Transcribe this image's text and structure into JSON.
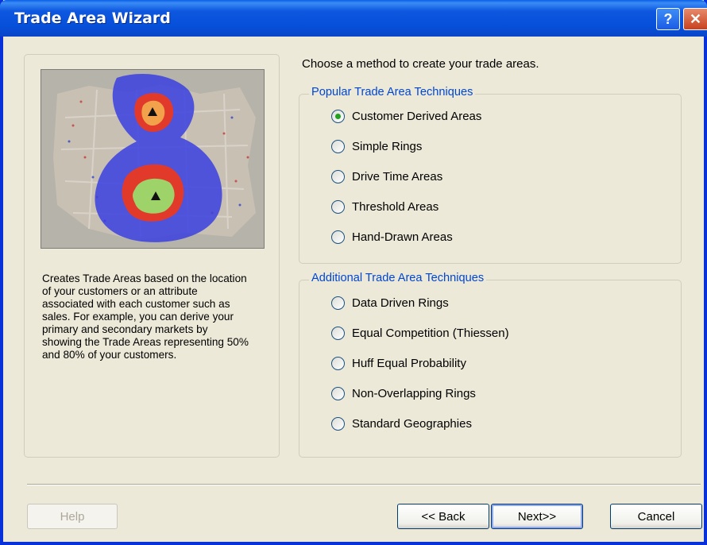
{
  "window": {
    "title": "Trade Area Wizard",
    "help_glyph": "?",
    "close_glyph": "✕"
  },
  "instruction": "Choose a method to create your trade areas.",
  "description": "Creates Trade Areas based on the location of your customers or an attribute associated with each customer such as sales. For example, you can derive your primary and secondary markets by showing the Trade Areas representing 50% and 80% of your customers.",
  "groups": {
    "popular": {
      "label": "Popular Trade Area Techniques",
      "options": [
        {
          "label": "Customer Derived Areas",
          "selected": true
        },
        {
          "label": "Simple Rings",
          "selected": false
        },
        {
          "label": "Drive Time Areas",
          "selected": false
        },
        {
          "label": "Threshold Areas",
          "selected": false
        },
        {
          "label": "Hand-Drawn Areas",
          "selected": false
        }
      ]
    },
    "additional": {
      "label": "Additional Trade Area Techniques",
      "options": [
        {
          "label": "Data Driven Rings",
          "selected": false
        },
        {
          "label": "Equal Competition (Thiessen)",
          "selected": false
        },
        {
          "label": "Huff Equal Probability",
          "selected": false
        },
        {
          "label": "Non-Overlapping Rings",
          "selected": false
        },
        {
          "label": "Standard Geographies",
          "selected": false
        }
      ]
    }
  },
  "buttons": {
    "help": "Help",
    "back": "<< Back",
    "next": "Next>>",
    "cancel": "Cancel"
  },
  "colors": {
    "titlebar": "#0650DA",
    "face": "#ECE9D8",
    "group_label": "#0046D5",
    "radio_selected": "#21A121"
  }
}
